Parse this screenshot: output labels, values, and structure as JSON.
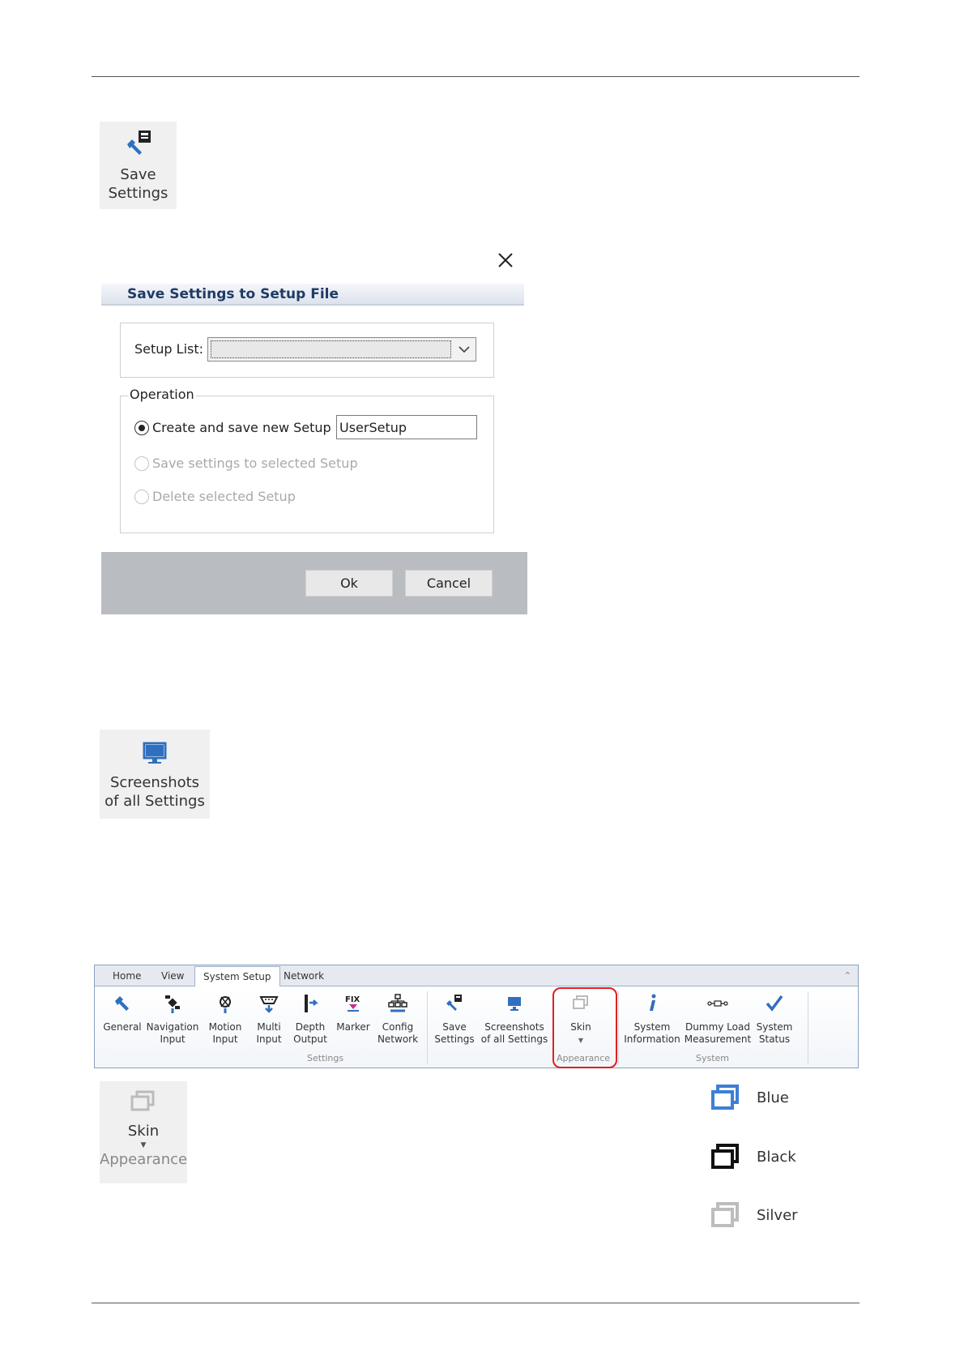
{
  "save_tile": {
    "label_line1": "Save",
    "label_line2": "Settings"
  },
  "dialog": {
    "title": "Save Settings to Setup File",
    "setup_list_label": "Setup List:",
    "setup_list_value": "",
    "operation_legend": "Operation",
    "options": [
      {
        "label": "Create and save new Setup",
        "selected": true,
        "enabled": true
      },
      {
        "label": "Save settings to selected Setup",
        "selected": false,
        "enabled": false
      },
      {
        "label": "Delete selected Setup",
        "selected": false,
        "enabled": false
      }
    ],
    "new_setup_name": "UserSetup",
    "ok_label": "Ok",
    "cancel_label": "Cancel"
  },
  "screenshots_tile": {
    "label_line1": "Screenshots",
    "label_line2": "of all Settings"
  },
  "ribbon": {
    "tabs": [
      "Home",
      "View",
      "System Setup",
      "Network"
    ],
    "active_tab": "System Setup",
    "settings_group": "Settings",
    "appearance_group": "Appearance",
    "system_group": "System",
    "buttons": [
      {
        "l1": "General",
        "l2": ""
      },
      {
        "l1": "Navigation",
        "l2": "Input"
      },
      {
        "l1": "Motion",
        "l2": "Input"
      },
      {
        "l1": "Multi",
        "l2": "Input"
      },
      {
        "l1": "Depth",
        "l2": "Output"
      },
      {
        "l1": "Marker",
        "l2": ""
      },
      {
        "l1": "Config",
        "l2": "Network"
      },
      {
        "l1": "Save",
        "l2": "Settings"
      },
      {
        "l1": "Screenshots",
        "l2": "of all Settings"
      },
      {
        "l1": "Skin",
        "l2": ""
      },
      {
        "l1": "System",
        "l2": "Information"
      },
      {
        "l1": "Dummy Load",
        "l2": "Measurement"
      },
      {
        "l1": "System",
        "l2": "Status"
      }
    ],
    "marker_icon_text": "FIX"
  },
  "skin_tile": {
    "label": "Skin",
    "group": "Appearance"
  },
  "skins": [
    {
      "name": "Blue",
      "color": "#3c7fd6"
    },
    {
      "name": "Black",
      "color": "#111111"
    },
    {
      "name": "Silver",
      "color": "#bdbdbd"
    }
  ],
  "colors": {
    "accent_blue": "#2f6fbf",
    "highlight_red": "#e02020",
    "dialog_title": "#1f3b66"
  }
}
